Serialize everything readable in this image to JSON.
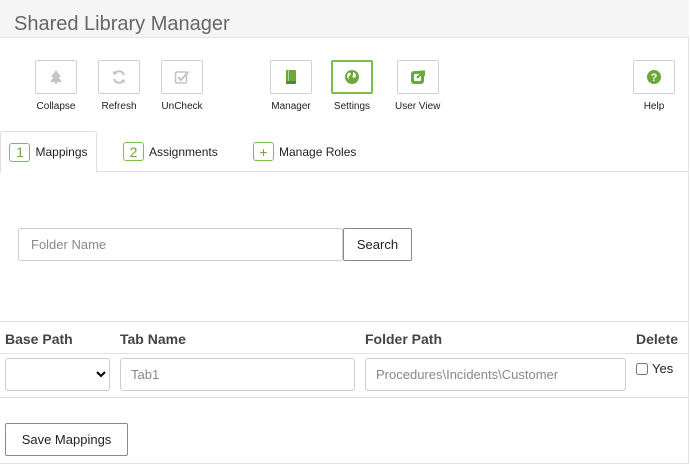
{
  "app": {
    "title": "Shared Library Manager"
  },
  "toolbar": {
    "collapse": {
      "label": "Collapse",
      "icon": "tree-icon"
    },
    "refresh": {
      "label": "Refresh",
      "icon": "refresh-icon"
    },
    "uncheck": {
      "label": "UnCheck",
      "icon": "checkbox-icon"
    },
    "manager": {
      "label": "Manager",
      "icon": "book-icon"
    },
    "settings": {
      "label": "Settings",
      "icon": "globe-icon"
    },
    "user_view": {
      "label": "User View",
      "icon": "external-link-icon"
    },
    "help": {
      "label": "Help",
      "icon": "question-icon"
    }
  },
  "tabs": [
    {
      "badge": "1",
      "label": "Mappings"
    },
    {
      "badge": "2",
      "label": "Assignments"
    },
    {
      "badge": "+",
      "label": "Manage Roles"
    }
  ],
  "search": {
    "placeholder": "Folder Name",
    "value": "",
    "button_label": "Search"
  },
  "table": {
    "headers": [
      "Base Path",
      "Tab Name",
      "Folder Path",
      "Delete"
    ],
    "row": {
      "base_path": "",
      "tab_name_placeholder": "Tab1",
      "folder_path_placeholder": "Procedures\\Incidents\\Customer",
      "delete_label": "Yes",
      "delete_checked": false
    }
  },
  "save_label": "Save Mappings",
  "colors": {
    "accent": "#7cc04a",
    "icon_gray": "#bdbdbd",
    "icon_green": "#6aa83a"
  }
}
